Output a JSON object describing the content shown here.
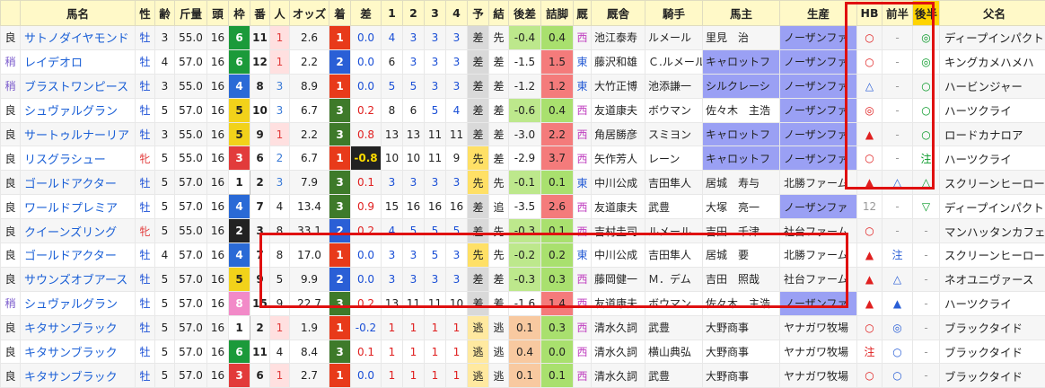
{
  "headers": [
    "",
    "馬名",
    "性",
    "齢",
    "斤量",
    "頭",
    "枠",
    "番",
    "人",
    "オッズ",
    "着",
    "差",
    "1",
    "2",
    "3",
    "4",
    "予",
    "結",
    "後差",
    "詰脚",
    "厩",
    "厩舎",
    "騎手",
    "馬主",
    "生産",
    "HB",
    "前半",
    "後半",
    "父名"
  ],
  "rows": [
    [
      "良",
      "サトノダイヤモンド",
      "牡",
      "3",
      "55.0",
      "16",
      "6",
      "11",
      "1",
      "2.6",
      "1",
      "0.0",
      "4",
      "3",
      "3",
      "3",
      "差",
      "先",
      "-0.4",
      "0.4",
      "西",
      "池江泰寿",
      "ルメール",
      "里見　治",
      "ノーザンファ",
      "○",
      "-",
      "◎",
      "ディープインパクト"
    ],
    [
      "稍",
      "レイデオロ",
      "牡",
      "4",
      "57.0",
      "16",
      "6",
      "12",
      "1",
      "2.2",
      "2",
      "0.0",
      "6",
      "3",
      "3",
      "3",
      "差",
      "差",
      "-1.5",
      "1.5",
      "東",
      "藤沢和雄",
      "Ｃ.ルメール",
      "キャロットフ",
      "ノーザンファ",
      "○",
      "-",
      "◎",
      "キングカメハメハ"
    ],
    [
      "稍",
      "ブラストワンピース",
      "牡",
      "3",
      "55.0",
      "16",
      "4",
      "8",
      "3",
      "8.9",
      "1",
      "0.0",
      "5",
      "5",
      "3",
      "3",
      "差",
      "差",
      "-1.2",
      "1.2",
      "東",
      "大竹正博",
      "池添謙一",
      "シルクレーシ",
      "ノーザンファ",
      "△",
      "-",
      "○",
      "ハービンジャー"
    ],
    [
      "良",
      "シュヴァルグラン",
      "牡",
      "5",
      "57.0",
      "16",
      "5",
      "10",
      "3",
      "6.7",
      "3",
      "0.2",
      "8",
      "6",
      "5",
      "4",
      "差",
      "差",
      "-0.6",
      "0.4",
      "西",
      "友道康夫",
      "ボウマン",
      "佐々木　主浩",
      "ノーザンファ",
      "◎",
      "-",
      "○",
      "ハーツクライ"
    ],
    [
      "良",
      "サートゥルナーリア",
      "牡",
      "3",
      "55.0",
      "16",
      "5",
      "9",
      "1",
      "2.2",
      "3",
      "0.8",
      "13",
      "13",
      "11",
      "11",
      "差",
      "差",
      "-3.0",
      "2.2",
      "西",
      "角居勝彦",
      "スミヨン",
      "キャロットフ",
      "ノーザンファ",
      "▲",
      "-",
      "○",
      "ロードカナロア"
    ],
    [
      "良",
      "リスグラシュー",
      "牝",
      "5",
      "55.0",
      "16",
      "3",
      "6",
      "2",
      "6.7",
      "1",
      "-0.8",
      "10",
      "10",
      "11",
      "9",
      "先",
      "差",
      "-2.9",
      "3.7",
      "西",
      "矢作芳人",
      "レーン",
      "キャロットフ",
      "ノーザンファ",
      "○",
      "-",
      "注",
      "ハーツクライ"
    ],
    [
      "良",
      "ゴールドアクター",
      "牡",
      "5",
      "57.0",
      "16",
      "1",
      "2",
      "3",
      "7.9",
      "3",
      "0.1",
      "3",
      "3",
      "3",
      "3",
      "先",
      "先",
      "-0.1",
      "0.1",
      "東",
      "中川公成",
      "吉田隼人",
      "居城　寿与",
      "北勝ファーム",
      "▲",
      "△",
      "△",
      "スクリーンヒーロー"
    ],
    [
      "良",
      "ワールドプレミア",
      "牡",
      "5",
      "57.0",
      "16",
      "4",
      "7",
      "4",
      "13.4",
      "3",
      "0.9",
      "15",
      "16",
      "16",
      "16",
      "差",
      "追",
      "-3.5",
      "2.6",
      "西",
      "友道康夫",
      "武豊",
      "大塚　亮一",
      "ノーザンファ",
      "12",
      "-",
      "▽",
      "ディープインパクト"
    ],
    [
      "良",
      "クイーンズリング",
      "牝",
      "5",
      "55.0",
      "16",
      "2",
      "3",
      "8",
      "33.1",
      "2",
      "0.2",
      "4",
      "5",
      "5",
      "5",
      "差",
      "先",
      "-0.3",
      "0.1",
      "西",
      "吉村圭司",
      "ルメール",
      "吉田　千津",
      "社台ファーム",
      "○",
      "-",
      "-",
      "マンハッタンカフェ"
    ],
    [
      "良",
      "ゴールドアクター",
      "牡",
      "4",
      "57.0",
      "16",
      "4",
      "7",
      "8",
      "17.0",
      "1",
      "0.0",
      "3",
      "3",
      "5",
      "3",
      "先",
      "先",
      "-0.2",
      "0.2",
      "東",
      "中川公成",
      "吉田隼人",
      "居城　要",
      "北勝ファーム",
      "▲",
      "注",
      "-",
      "スクリーンヒーロー"
    ],
    [
      "良",
      "サウンズオブアース",
      "牡",
      "5",
      "57.0",
      "16",
      "5",
      "9",
      "5",
      "9.9",
      "2",
      "0.0",
      "3",
      "3",
      "3",
      "3",
      "差",
      "差",
      "-0.3",
      "0.3",
      "西",
      "藤岡健一",
      "Ｍ．デム",
      "吉田　照哉",
      "社台ファーム",
      "▲",
      "△",
      "-",
      "ネオユニヴァース"
    ],
    [
      "稍",
      "シュヴァルグラン",
      "牡",
      "5",
      "57.0",
      "16",
      "8",
      "15",
      "9",
      "22.7",
      "3",
      "0.2",
      "13",
      "11",
      "11",
      "10",
      "差",
      "差",
      "-1.6",
      "1.4",
      "西",
      "友道康夫",
      "ボウマン",
      "佐々木　主浩",
      "ノーザンファ",
      "▲",
      "▲",
      "-",
      "ハーツクライ"
    ],
    [
      "良",
      "キタサンブラック",
      "牡",
      "5",
      "57.0",
      "16",
      "1",
      "2",
      "1",
      "1.9",
      "1",
      "-0.2",
      "1",
      "1",
      "1",
      "1",
      "逃",
      "逃",
      "0.1",
      "0.3",
      "西",
      "清水久詞",
      "武豊",
      "大野商事",
      "ヤナガワ牧場",
      "○",
      "◎",
      "-",
      "ブラックタイド"
    ],
    [
      "良",
      "キタサンブラック",
      "牡",
      "5",
      "57.0",
      "16",
      "6",
      "11",
      "4",
      "8.4",
      "3",
      "0.1",
      "1",
      "1",
      "1",
      "1",
      "逃",
      "逃",
      "0.4",
      "0.0",
      "西",
      "清水久詞",
      "横山典弘",
      "大野商事",
      "ヤナガワ牧場",
      "注",
      "○",
      "-",
      "ブラックタイド"
    ],
    [
      "良",
      "キタサンブラック",
      "牡",
      "5",
      "57.0",
      "16",
      "3",
      "6",
      "1",
      "2.7",
      "1",
      "0.0",
      "1",
      "1",
      "1",
      "1",
      "逃",
      "逃",
      "0.1",
      "0.1",
      "西",
      "清水久詞",
      "武豊",
      "大野商事",
      "ヤナガワ牧場",
      "○",
      "○",
      "-",
      "ブラックタイド"
    ]
  ],
  "colors": {
    "frame": {
      "1": "#ffffff",
      "2": "#222222",
      "3": "#e23b3b",
      "4": "#2a6ad6",
      "5": "#f2d21a",
      "6": "#1b9a3a",
      "7": "#f07a1a",
      "8": "#f28ac8"
    },
    "finish": {
      "1": "#e83a1a",
      "2": "#2a5fd6",
      "3": "#3e7a2a"
    },
    "highlight": "#e01010"
  }
}
